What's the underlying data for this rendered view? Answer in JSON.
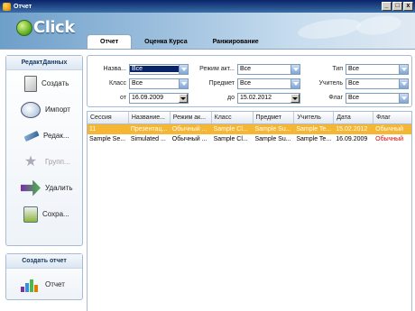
{
  "window": {
    "title": "Отчет",
    "minimize": "_",
    "maximize": "□",
    "close": "x"
  },
  "logo": {
    "text": "Click"
  },
  "tabs": [
    {
      "label": "Отчет"
    },
    {
      "label": "Оценка Курса"
    },
    {
      "label": "Ранжирование"
    }
  ],
  "sidebar": {
    "header": "РедактДанных",
    "items": [
      {
        "label": "Создать",
        "icon": "document-icon"
      },
      {
        "label": "Импорт",
        "icon": "import-icon"
      },
      {
        "label": "Редак...",
        "icon": "edit-icon"
      },
      {
        "label": "Групп...",
        "icon": "group-icon"
      },
      {
        "label": "Удалить",
        "icon": "delete-icon"
      },
      {
        "label": "Сохра...",
        "icon": "save-icon"
      }
    ],
    "report_header": "Создать отчет",
    "report_item": {
      "label": "Отчет",
      "icon": "chart-icon"
    }
  },
  "filters": {
    "name": {
      "label": "Назва...",
      "value": "Все"
    },
    "mode": {
      "label": "Режим акт...",
      "value": "Все"
    },
    "type": {
      "label": "Тип",
      "value": "Все"
    },
    "class": {
      "label": "Класс",
      "value": "Все"
    },
    "subject": {
      "label": "Предмет",
      "value": "Все"
    },
    "teacher": {
      "label": "Учитель",
      "value": "Все"
    },
    "date_from": {
      "label": "от",
      "value": "16.09.2009"
    },
    "date_to": {
      "label": "до",
      "value": "15.02.2012"
    },
    "flag": {
      "label": "Флаг",
      "value": "Все"
    }
  },
  "grid": {
    "columns": [
      "Сессия",
      "Название...",
      "Режим ак...",
      "Класс",
      "Предмет",
      "Учитель",
      "Дата",
      "Флаг"
    ],
    "rows": [
      [
        "11",
        "Презентац...",
        "Обычный ...",
        "Sample Cl...",
        "Sample Su...",
        "Sample Te...",
        "15.02.2012",
        "Обычный"
      ],
      [
        "Sample Se...",
        "Simulated ...",
        "Обычный ...",
        "Sample Cl...",
        "Sample Su...",
        "Sample Te...",
        "16.09.2009",
        "Обычный"
      ]
    ],
    "flag_color": "#e00000",
    "selected_color": "#f5b634"
  }
}
